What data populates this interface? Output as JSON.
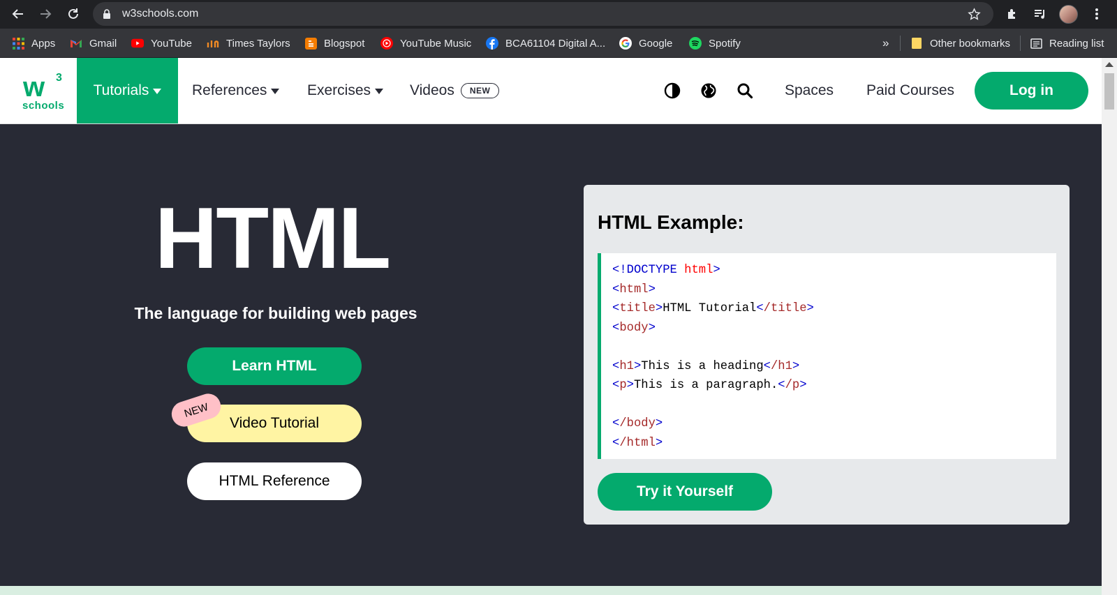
{
  "browser": {
    "url": "w3schools.com",
    "bookmarks": [
      {
        "label": "Apps",
        "icon": "apps-grid-icon"
      },
      {
        "label": "Gmail",
        "icon": "gmail-icon"
      },
      {
        "label": "YouTube",
        "icon": "youtube-icon"
      },
      {
        "label": "Times Taylors",
        "icon": "times-taylors-icon"
      },
      {
        "label": "Blogspot",
        "icon": "blogger-icon"
      },
      {
        "label": "YouTube Music",
        "icon": "youtube-music-icon"
      },
      {
        "label": "BCA61104 Digital A...",
        "icon": "facebook-icon"
      },
      {
        "label": "Google",
        "icon": "google-icon"
      },
      {
        "label": "Spotify",
        "icon": "spotify-icon"
      }
    ],
    "more_bookmarks": "»",
    "other_bookmarks": "Other bookmarks",
    "reading_list": "Reading list"
  },
  "site": {
    "logo": {
      "mark": "w",
      "sup": "3",
      "word": "schools"
    },
    "nav": {
      "tutorials": "Tutorials",
      "references": "References",
      "exercises": "Exercises",
      "videos": "Videos",
      "videos_badge": "NEW",
      "spaces": "Spaces",
      "paid_courses": "Paid Courses",
      "login": "Log in"
    },
    "accent_color": "#04aa6d"
  },
  "hero": {
    "title": "HTML",
    "subtitle": "The language for building web pages",
    "learn_button": "Learn HTML",
    "video_button": "Video Tutorial",
    "new_tag": "NEW",
    "reference_button": "HTML Reference"
  },
  "example": {
    "title": "HTML Example:",
    "code": {
      "doctype_open": "<!DOCTYPE",
      "doctype_attr": " html",
      "doctype_close": ">",
      "html_open_tag": "html",
      "title_tag": "title",
      "title_text": "HTML Tutorial",
      "title_close_tag": "/title",
      "body_tag": "body",
      "h1_tag": "h1",
      "h1_text": "This is a heading",
      "h1_close_tag": "/h1",
      "p_tag": "p",
      "p_text": "This is a paragraph.",
      "p_close_tag": "/p",
      "body_close_tag": "/body",
      "html_close_tag": "/html",
      "lt": "<",
      "gt": ">"
    },
    "try_button": "Try it Yourself"
  }
}
